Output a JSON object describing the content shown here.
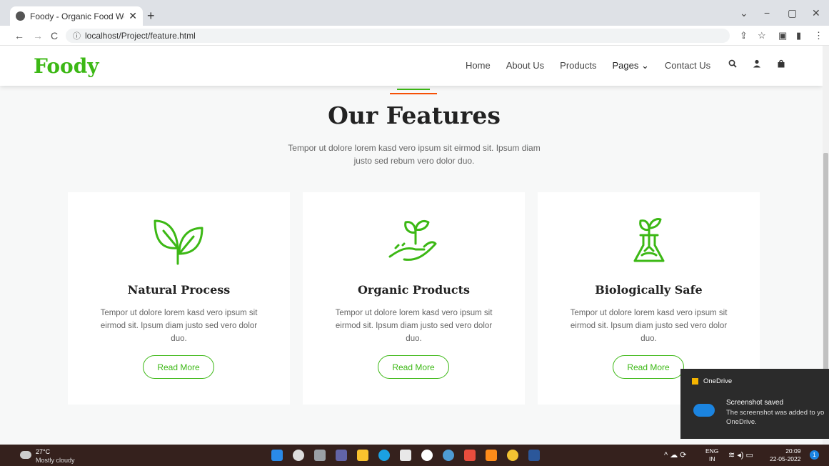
{
  "browser": {
    "tab_title": "Foody - Organic Food Website T",
    "url": "localhost/Project/feature.html",
    "new_tab": "+",
    "tab_close": "✕",
    "back": "←",
    "forward": "→",
    "reload": "C",
    "minimize": "−",
    "maximize": "▢",
    "close": "✕",
    "collapse": "⌄"
  },
  "header": {
    "logo": "Foody",
    "nav": [
      "Home",
      "About Us",
      "Products",
      "Pages ⌄",
      "Contact Us"
    ],
    "icons": [
      "search-icon",
      "user-icon",
      "bag-icon"
    ]
  },
  "features": {
    "title": "Our Features",
    "subtitle": "Tempor ut dolore lorem kasd vero ipsum sit eirmod sit. Ipsum diam justo sed rebum vero dolor duo.",
    "cards": [
      {
        "icon": "leaves-icon",
        "title": "Natural Process",
        "text": "Tempor ut dolore lorem kasd vero ipsum sit eirmod sit. Ipsum diam justo sed vero dolor duo.",
        "button": "Read More"
      },
      {
        "icon": "hand-plant-icon",
        "title": "Organic Products",
        "text": "Tempor ut dolore lorem kasd vero ipsum sit eirmod sit. Ipsum diam justo sed vero dolor duo.",
        "button": "Read More"
      },
      {
        "icon": "flask-plant-icon",
        "title": "Biologically Safe",
        "text": "Tempor ut dolore lorem kasd vero ipsum sit eirmod sit. Ipsum diam justo sed vero dolor duo.",
        "button": "Read More"
      }
    ]
  },
  "toast": {
    "app": "OneDrive",
    "title": "Screenshot saved",
    "body": "The screenshot was added to yo",
    "body2": "OneDrive."
  },
  "taskbar": {
    "temp": "27°C",
    "weather": "Mostly cloudy",
    "lang1": "ENG",
    "lang2": "IN",
    "time": "20:09",
    "date": "22-05-2022",
    "badge": "1"
  },
  "colors": {
    "brand": "#3cb815",
    "accent": "#f65005"
  }
}
